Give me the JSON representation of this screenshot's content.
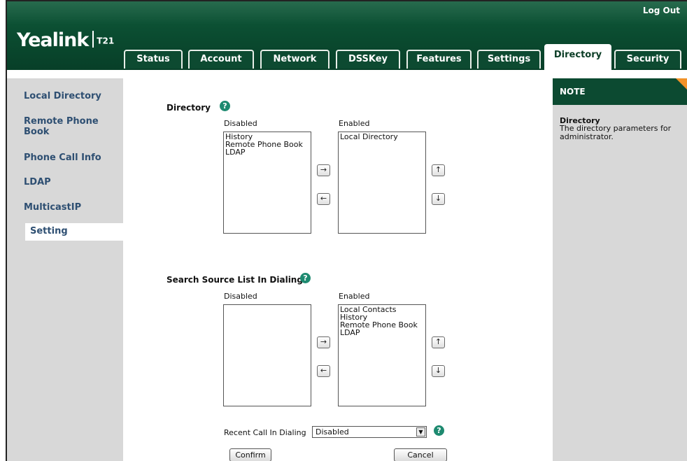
{
  "header": {
    "logo_text": "Yealink",
    "model": "T21",
    "logout_label": "Log Out"
  },
  "tabs": [
    {
      "label": "Status"
    },
    {
      "label": "Account"
    },
    {
      "label": "Network"
    },
    {
      "label": "DSSKey"
    },
    {
      "label": "Features"
    },
    {
      "label": "Settings"
    },
    {
      "label": "Directory",
      "active": true
    },
    {
      "label": "Security"
    }
  ],
  "sidebar": {
    "items": [
      {
        "label": "Local Directory"
      },
      {
        "label": "Remote Phone Book"
      },
      {
        "label": "Phone Call Info"
      },
      {
        "label": "LDAP"
      },
      {
        "label": "MulticastIP"
      },
      {
        "label": "Setting",
        "active": true
      }
    ]
  },
  "directory": {
    "title": "Directory",
    "disabled_label": "Disabled",
    "enabled_label": "Enabled",
    "disabled_items": [
      "History",
      "Remote Phone Book",
      "LDAP"
    ],
    "enabled_items": [
      "Local Directory"
    ]
  },
  "search_source": {
    "title": "Search Source List In Dialing",
    "disabled_label": "Disabled",
    "enabled_label": "Enabled",
    "disabled_items": [],
    "enabled_items": [
      "Local Contacts",
      "History",
      "Remote Phone Book",
      "LDAP"
    ]
  },
  "recent_call": {
    "label": "Recent Call In Dialing",
    "value": "Disabled"
  },
  "buttons": {
    "confirm": "Confirm",
    "cancel": "Cancel",
    "move_right": "→",
    "move_left": "←",
    "move_up": "↑",
    "move_down": "↓"
  },
  "note": {
    "heading": "NOTE",
    "title": "Directory",
    "text": "The directory parameters for administrator."
  },
  "colors": {
    "header_green": "#0a4a2f",
    "sidebar_gray": "#d8d8d8",
    "link_blue": "#2e4f72",
    "note_accent": "#f29228",
    "help_icon": "#1e8a70"
  }
}
